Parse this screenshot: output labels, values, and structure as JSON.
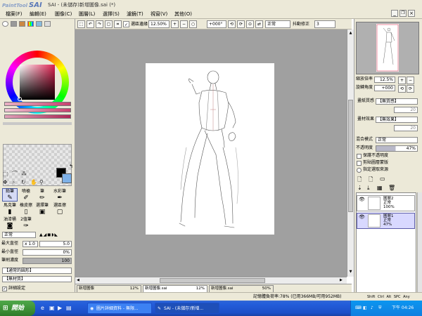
{
  "app": {
    "logo": "SAI",
    "logo_prefix": "PaintTool",
    "window_title": "SAI - (未儲存)新增圖像.sai (*)"
  },
  "menu": [
    "檔案(F)",
    "編輯(E)",
    "圖像(C)",
    "圖層(L)",
    "選擇(S)",
    "濾鏡(T)",
    "視窗(V)",
    "其他(O)"
  ],
  "toolbar": {
    "selection_edge_label": "選區邊緣",
    "zoom": "12.50%",
    "angle": "+000°",
    "blend_mode": "正常",
    "stabilizer_label": "抖動修正",
    "stabilizer_value": "3"
  },
  "tools": {
    "brush_row1": [
      "鉛筆",
      "噴槍",
      "筆",
      "水彩筆"
    ],
    "brush_row2": [
      "馬克筆",
      "橡皮擦",
      "選擇筆",
      "選區擦"
    ],
    "brush_row3": [
      "油漆桶",
      "2值筆"
    ],
    "brush_mode": "正常",
    "max_diameter_label": "最大直徑",
    "max_diameter_mult": "x 1.0",
    "max_diameter_value": "5.0",
    "min_diameter_label": "最小直徑",
    "min_diameter_value": "0%",
    "density_label": "筆刷濃度",
    "density_value": "100",
    "shape_select": "【通常的圓形】",
    "texture_select": "【無材質】",
    "detail_setting": "詳細設定"
  },
  "navigator": {
    "zoom_label": "縮放倍率",
    "zoom_value": "12.5%",
    "angle_label": "旋轉角度",
    "angle_value": "+000"
  },
  "layer_panel": {
    "paper_texture_label": "畫紙質感",
    "paper_texture_value": "【無質感】",
    "paper_texture_strength": "20",
    "paper_effect_label": "畫材效果",
    "paper_effect_value": "【無效果】",
    "paper_effect_strength": "20",
    "blend_mode_label": "混合模式",
    "blend_mode_value": "正常",
    "opacity_label": "不透明度",
    "opacity_value": "47%",
    "opacity_fraction": 0.47,
    "preserve_opacity": "保護不透明度",
    "clipping_group": "剪貼圖層蒙版",
    "selection_source": "指定選取來源",
    "layers": [
      {
        "name": "圖層2",
        "mode": "正常",
        "opacity": "100%",
        "selected": false
      },
      {
        "name": "圖層1",
        "mode": "正常",
        "opacity": "47%",
        "selected": true
      }
    ]
  },
  "file_tabs": [
    {
      "name": "新增圖像",
      "zoom": "12%",
      "selected": false
    },
    {
      "name": "新增圖像.sai",
      "zoom": "12%",
      "selected": true
    },
    {
      "name": "新增圖像.sai",
      "zoom": "50%",
      "selected": false
    }
  ],
  "status": {
    "memory": "記憶體負荷率:78% (已用366MB/可用952MB)",
    "keys": [
      "Shift",
      "Ctrl",
      "Alt",
      "SPC",
      "Any"
    ]
  },
  "taskbar": {
    "start": "開始",
    "tasks": [
      "圖片詳細資料 - 無限...",
      "SAI - (未儲存)新增..."
    ],
    "clock": "下午 04:26"
  },
  "colors": {
    "ui_bg": "#ece9d8",
    "canvas_bg": "#a0a0a0",
    "foreground": "#000000",
    "background": "#7eb1e8",
    "accent_pink": "#c8406e",
    "taskbar": "#245edb"
  }
}
